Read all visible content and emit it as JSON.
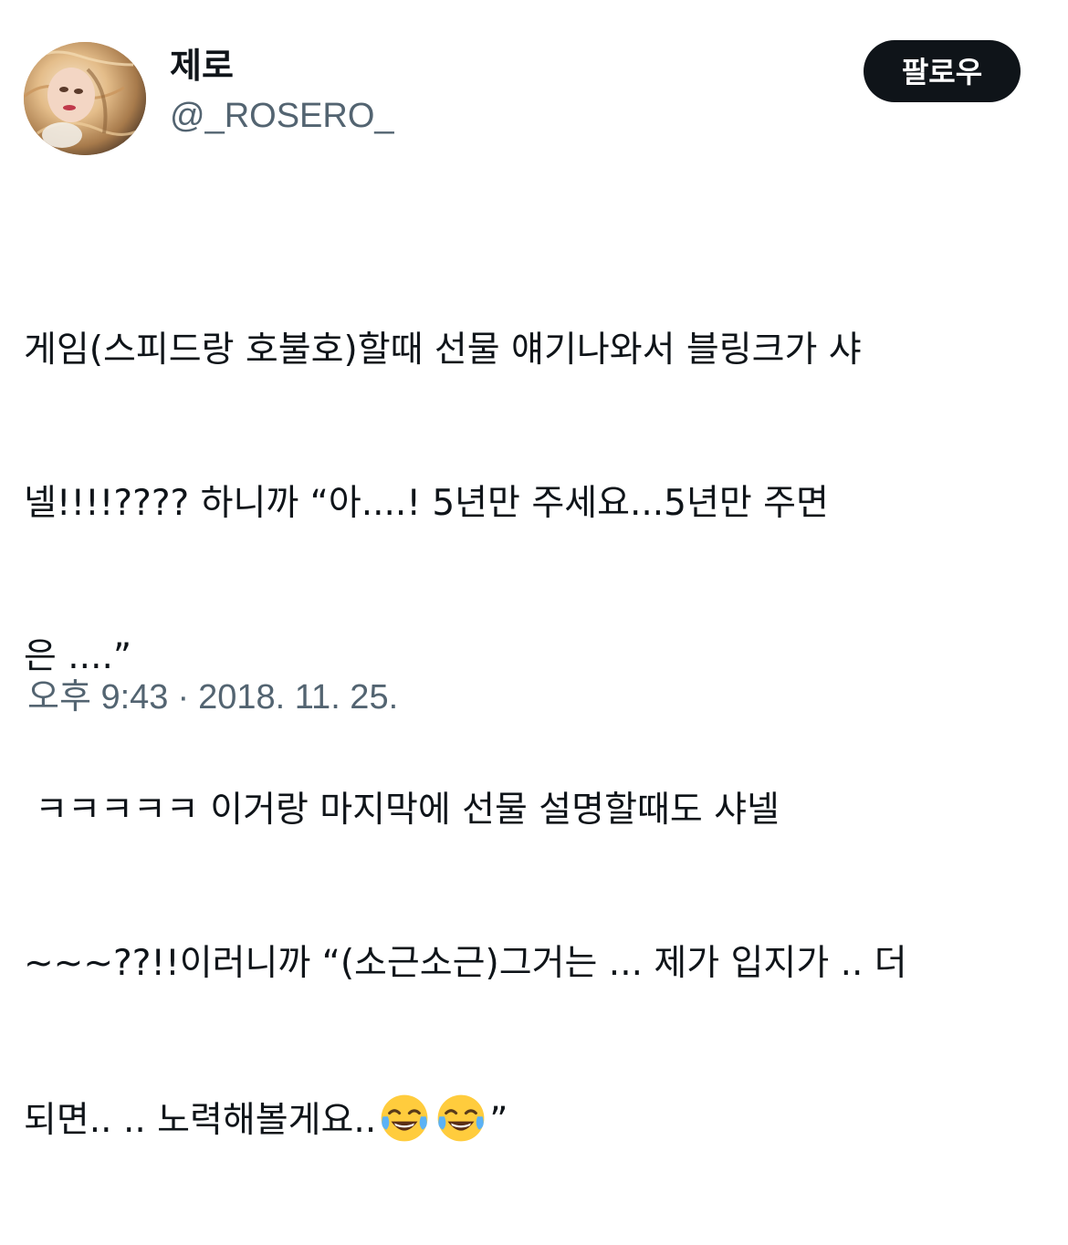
{
  "user": {
    "display_name": "제로",
    "handle": "@_ROSERO_",
    "avatar_icon": "profile-photo"
  },
  "follow_button": {
    "label": "팔로우"
  },
  "tweet": {
    "lines": [
      "게임(스피드랑 호불호)할때 선물 얘기나와서 블링크가 샤",
      "넬!!!!???? 하니까 “아....! 5년만 주세요...5년만 주면",
      "은 ....”",
      " ㅋㅋㅋㅋㅋ 이거랑 마지막에 선물 설명할때도 샤넬",
      "~~~??!!이러니까 “(소근소근)그거는 ... 제가 입지가 .. 더"
    ],
    "last_line_text": "되면.. .. 노력해볼게요..",
    "last_line_end": "”",
    "emoji": "face-with-tears-of-joy"
  },
  "timestamp": {
    "time": "오후 9:43",
    "separator": "·",
    "date": "2018. 11. 25."
  },
  "colors": {
    "text_primary": "#0f1419",
    "text_secondary": "#536471",
    "button_bg": "#0f1419",
    "button_text": "#ffffff"
  }
}
